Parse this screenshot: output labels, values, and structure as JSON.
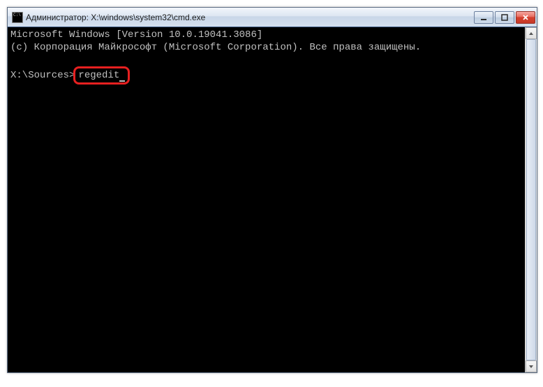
{
  "window": {
    "title": "Администратор: X:\\windows\\system32\\cmd.exe"
  },
  "console": {
    "line1": "Microsoft Windows [Version 10.0.19041.3086]",
    "line2": "(c) Корпорация Майкрософт (Microsoft Corporation). Все права защищены.",
    "prompt": "X:\\Sources>",
    "command": "regedit"
  }
}
